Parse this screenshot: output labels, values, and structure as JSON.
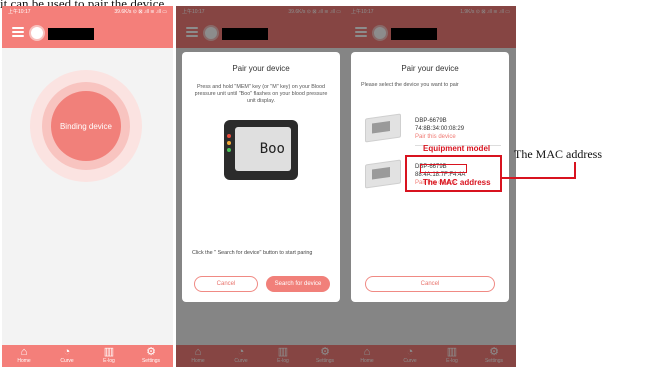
{
  "caption": "it can be used to pair the device.",
  "status": {
    "time": "上午10:17",
    "right_1": "39.6K/s ⊙ ⊠ .ıll ≋ .ıll ▭",
    "right_2": "39.6K/s ⊙ ⊠ .ıll ≋ .ıll ▭",
    "right_3": "1.9K/s ⊙ ⊠ .ıll ≋ .ıll ▭"
  },
  "tabs": [
    {
      "label": "Home",
      "icon": "home-icon"
    },
    {
      "label": "Curve",
      "icon": "curve-icon"
    },
    {
      "label": "E-log",
      "icon": "elog-icon"
    },
    {
      "label": "Settings",
      "icon": "settings-icon"
    }
  ],
  "screen1": {
    "binding_button": "Binding device"
  },
  "screen2": {
    "title": "Pair your device",
    "instruction": "Press and hold \"MEM\" key (or \"M\" key) on your Blood pressure unit until \"Boo\" flashes on your blood pressure unit display.",
    "display_text": "Boo",
    "hint": "Click the \" Search for device\" button to start paring",
    "cancel": "Cancel",
    "search": "Search for device"
  },
  "screen3": {
    "title": "Pair your device",
    "instruction": "Please select the device you want to pair",
    "devices": [
      {
        "model": "DBP-6679B",
        "mac": "74:8B:34:00:08:29",
        "action": "Pair this device"
      },
      {
        "model": "DBP-6679B",
        "mac": "88:4A:18:7F:F4:4A",
        "action": "Pair this device"
      }
    ],
    "cancel": "Cancel"
  },
  "annotations": {
    "equipment_model": "Equipment model",
    "mac_short": "The MAC address",
    "mac_long": "The MAC address"
  },
  "colors": {
    "accent": "#f47f7a",
    "annotation": "#d8131f"
  }
}
